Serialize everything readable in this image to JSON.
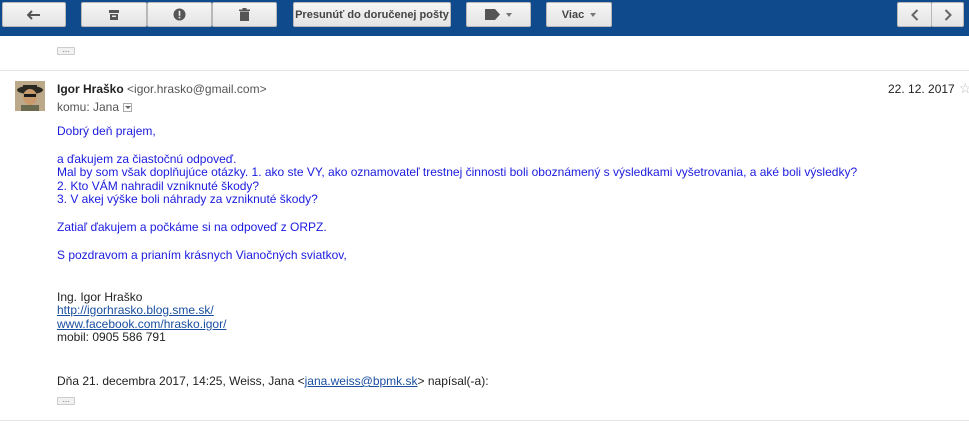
{
  "toolbar": {
    "move_label": "Presunúť do doručenej pošty",
    "more_label": "Viac",
    "accent": "#0f4a8c"
  },
  "message": {
    "sender_name": "Igor Hraško",
    "sender_email": "<igor.hrasko@gmail.com>",
    "date": "22. 12. 2017",
    "to_label": "komu: Jana",
    "body": {
      "greeting": "Dobrý deň prajem,",
      "thanks": "a ďakujem za čiastočnú odpoveď.",
      "q1": "Mal by som však doplňujúce otázky. 1. ako ste VY, ako oznamovateľ trestnej činnosti boli oboznámený s výsledkami vyšetrovania, a aké boli výsledky?",
      "q2": "2. Kto VÁM nahradil vzniknuté škody?",
      "q3": "3. V akej výške boli náhrady za vzniknuté škody?",
      "wait": "Zatiaľ ďakujem a počkáme si na odpoveď z ORPZ.",
      "closing": "S pozdravom a prianím krásnych Vianočných sviatkov,"
    },
    "signature": {
      "name": "Ing. Igor Hraško",
      "link1": "http://igorhrasko.blog.sme.sk/",
      "link2": "www.facebook.com/hrasko.igor/",
      "mobile": "mobil: 0905 586 791"
    },
    "quote": {
      "prefix": "Dňa 21. decembra 2017, 14:25, Weiss, Jana <",
      "email": "jana.weiss@bpmk.sk",
      "suffix": "> napísal(-a):"
    },
    "ellipsis": "..."
  }
}
